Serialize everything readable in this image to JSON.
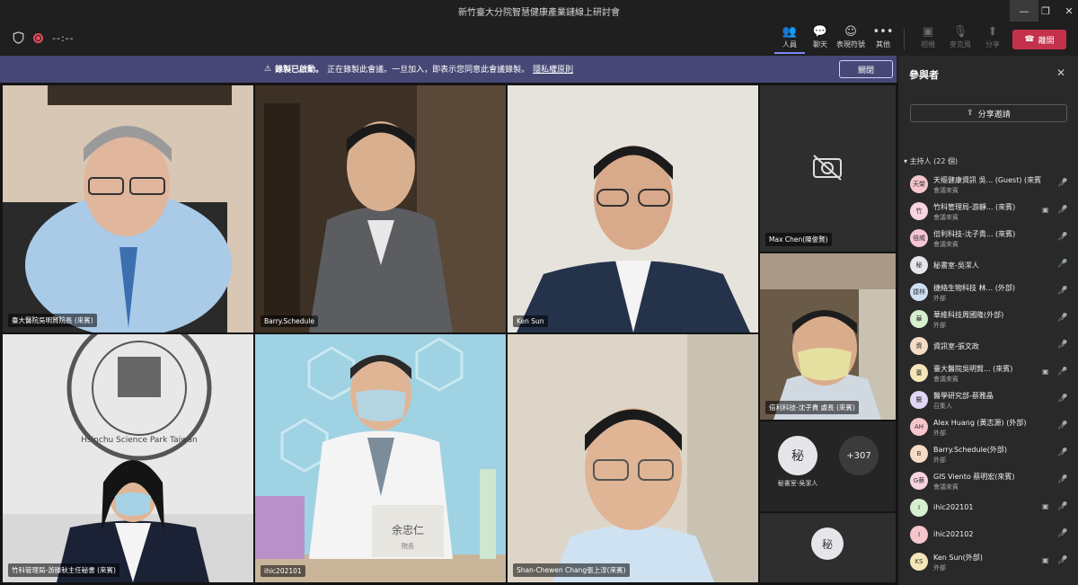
{
  "window": {
    "title": "新竹臺大分院智慧健康產業鏈線上研討會"
  },
  "toolbar": {
    "timer": "--:--",
    "buttons": [
      {
        "label": "人員",
        "icon": "people-icon"
      },
      {
        "label": "聊天",
        "icon": "chat-icon"
      },
      {
        "label": "表現符號",
        "icon": "reactions-icon"
      },
      {
        "label": "其他",
        "icon": "more-icon"
      },
      {
        "label": "相機",
        "icon": "camera-icon"
      },
      {
        "label": "麥克風",
        "icon": "microphone-icon"
      },
      {
        "label": "分享",
        "icon": "share-icon"
      }
    ],
    "leave_label": "離開"
  },
  "banner": {
    "title": "錄製已啟動。",
    "message": "正在錄製此會議。一旦加入，即表示您同意此會議錄製。",
    "link": "隱私權原則",
    "close_label": "關閉"
  },
  "tiles": [
    {
      "name": "臺大醫院吳明賢院長 (來賓)"
    },
    {
      "name": "Barry.Schedule"
    },
    {
      "name": "Ken Sun"
    },
    {
      "name": "Max Chen(陳俊賢)"
    },
    {
      "name": "竹科管理局-游滕秋主任秘書 (來賓)"
    },
    {
      "name": "ihic202101"
    },
    {
      "name": "Shan-Chewen Chang張上淳(來賓)"
    },
    {
      "name": "倍利科技-沈子貴 處長 (來賓)"
    }
  ],
  "desk_sign": {
    "name": "余忠仁",
    "subtitle": "院長"
  },
  "logo_text": "Hsinchu Science Park Taiwan",
  "side": {
    "avatar_initial": "秘",
    "avatar_name": "秘書室-吳潔人",
    "more_count": "+307",
    "bottom_avatar_initial": "秘"
  },
  "panel": {
    "title": "參與者",
    "share_label": "分享邀請",
    "section_label": "主持人 (22 個)",
    "participants": [
      {
        "initials": "天榮",
        "color": "#f5c6cb",
        "name": "天樞健康資訊 吳... (Guest) (來賓)",
        "sub": "會議來賓"
      },
      {
        "initials": "竹",
        "color": "#f8d3e0",
        "name": "竹科管理局-游靜... (來賓)",
        "sub": "會議來賓"
      },
      {
        "initials": "倍威",
        "color": "#f5c6d8",
        "name": "倍利科技-沈子貴... (來賓)",
        "sub": "會議來賓"
      },
      {
        "initials": "秘",
        "color": "#e6e6ea",
        "name": "秘書室-吳潔人",
        "sub": ""
      },
      {
        "initials": "捷林",
        "color": "#cfe0f5",
        "name": "捷絡生物科技 林... (外部)",
        "sub": "外部"
      },
      {
        "initials": "華",
        "color": "#d6f0cf",
        "name": "華維科技周國隆(外部)",
        "sub": "外部"
      },
      {
        "initials": "資",
        "color": "#f5dcc6",
        "name": "資訊室-張文政",
        "sub": ""
      },
      {
        "initials": "臺",
        "color": "#f5e6b8",
        "name": "臺大醫院吳明賢... (來賓)",
        "sub": "會議來賓"
      },
      {
        "initials": "醫",
        "color": "#e0d6f5",
        "name": "醫學研究部-蔡雅晶",
        "sub": "召集人"
      },
      {
        "initials": "AH",
        "color": "#f5c6cb",
        "name": "Alex Huang (黃志源) (外部)",
        "sub": "外部"
      },
      {
        "initials": "B",
        "color": "#f5dcc6",
        "name": "Barry.Schedule(外部)",
        "sub": "外部"
      },
      {
        "initials": "G蔡",
        "color": "#f8d3e0",
        "name": "GIS Viento 蔡明宏(來賓)",
        "sub": "會議來賓"
      },
      {
        "initials": "I",
        "color": "#d6f0cf",
        "name": "ihic202101",
        "sub": ""
      },
      {
        "initials": "I",
        "color": "#f5c6cb",
        "name": "ihic202102",
        "sub": ""
      },
      {
        "initials": "KS",
        "color": "#f5e6b8",
        "name": "Ken Sun(外部)",
        "sub": "外部"
      }
    ]
  }
}
